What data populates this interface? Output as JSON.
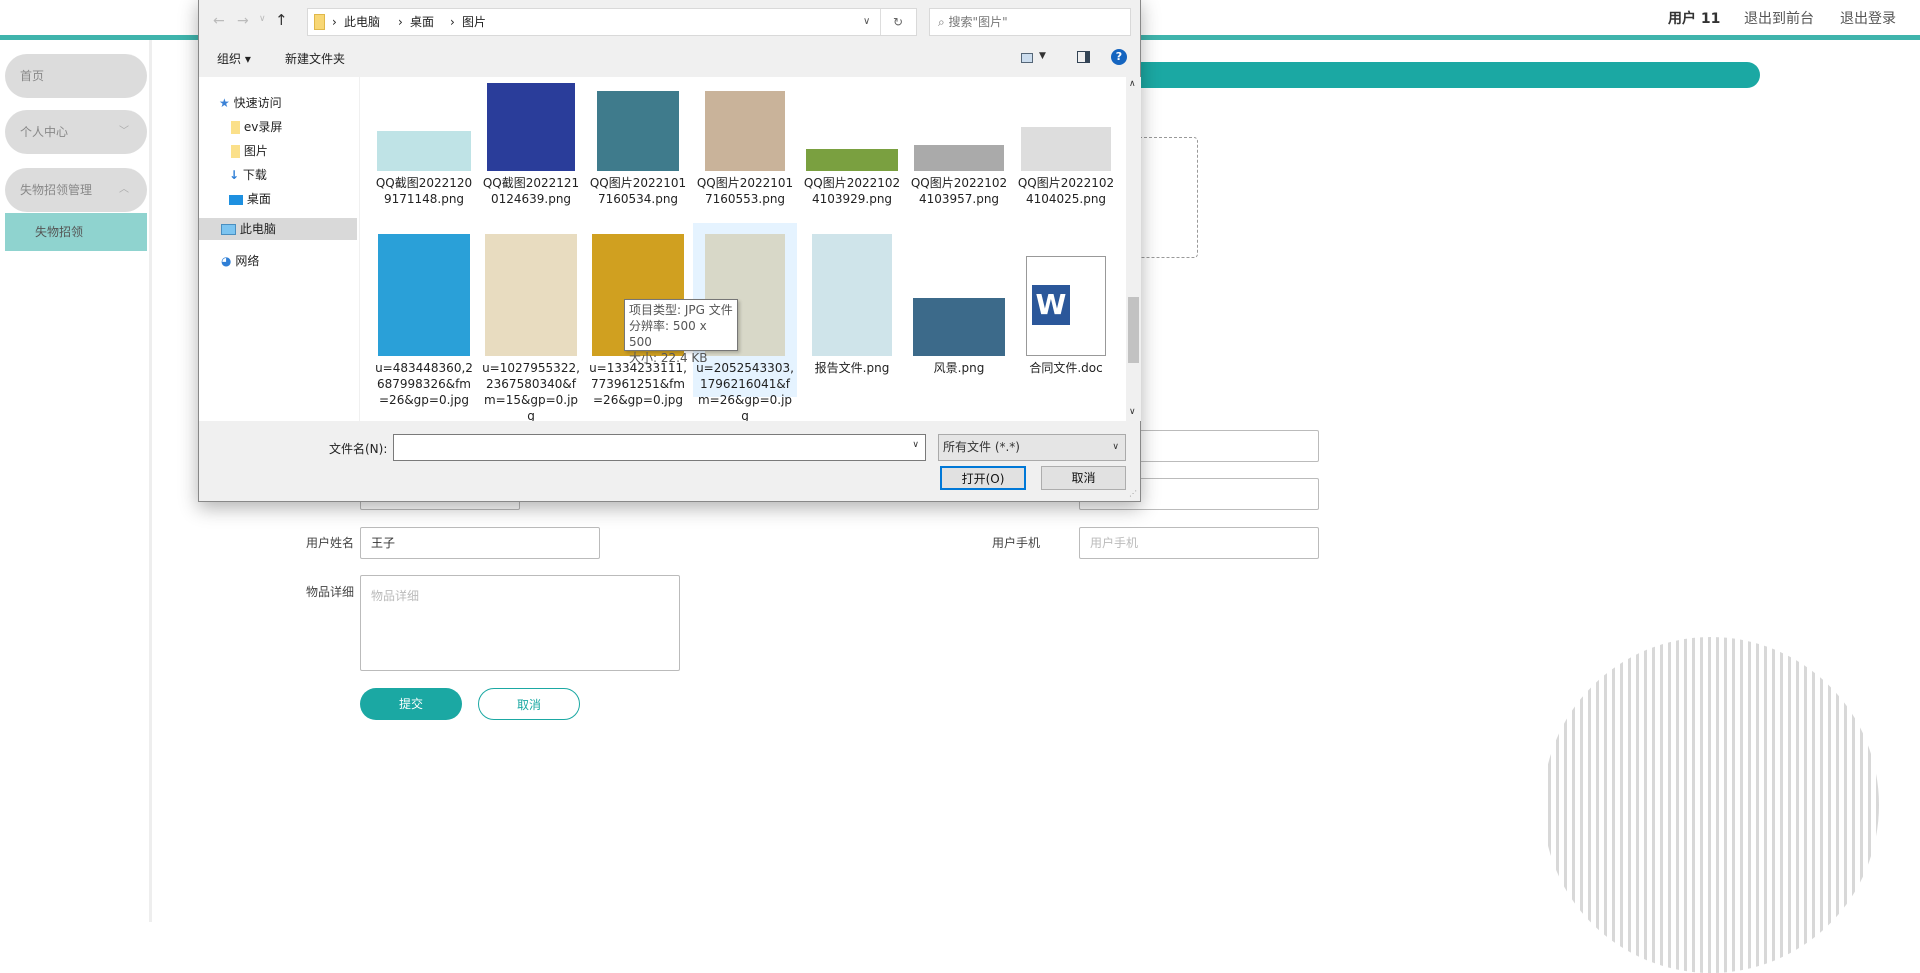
{
  "header": {
    "user": "用户 11",
    "back_front": "退出到前台",
    "logout": "退出登录"
  },
  "colors": {
    "accent": "#1ba8a3",
    "sidebar_active": "#8fd3cf"
  },
  "sidebar": {
    "items": [
      {
        "label": "首页"
      },
      {
        "label": "个人中心",
        "icon": "chevron-down-icon"
      },
      {
        "label": "失物招领管理",
        "icon": "chevron-up-icon"
      }
    ],
    "active_sub": "失物招领"
  },
  "form": {
    "name_label": "用户姓名",
    "name_value": "王子",
    "phone_label": "用户手机",
    "phone_placeholder": "用户手机",
    "detail_label": "物品详细",
    "detail_placeholder": "物品详细",
    "submit": "提交",
    "cancel": "取消"
  },
  "dialog": {
    "breadcrumb": [
      "此电脑",
      "桌面",
      "图片"
    ],
    "search_placeholder": "搜索\"图片\"",
    "toolbar": {
      "organize": "组织 ▾",
      "new_folder": "新建文件夹"
    },
    "nav": [
      {
        "label": "快速访问",
        "icon": "star-icon"
      },
      {
        "label": "ev录屏",
        "icon": "folder-icon"
      },
      {
        "label": "图片",
        "icon": "folder-icon"
      },
      {
        "label": "下载",
        "icon": "download-icon"
      },
      {
        "label": "桌面",
        "icon": "desktop-icon"
      },
      {
        "label": "此电脑",
        "icon": "computer-icon"
      },
      {
        "label": "网络",
        "icon": "network-icon"
      }
    ],
    "files_row1": [
      {
        "name": "QQ截图20221209171148.png"
      },
      {
        "name": "QQ截图20221210124639.png"
      },
      {
        "name": "QQ图片20221017160534.png"
      },
      {
        "name": "QQ图片20221017160553.png"
      },
      {
        "name": "QQ图片20221024103929.png"
      },
      {
        "name": "QQ图片20221024103957.png"
      },
      {
        "name": "QQ图片20221024104025.png"
      }
    ],
    "files_row2": [
      {
        "name": "u=483448360,2687998326&fm=26&gp=0.jpg"
      },
      {
        "name": "u=1027955322,2367580340&fm=15&gp=0.jpg"
      },
      {
        "name": "u=1334233111,773961251&fm=26&gp=0.jpg"
      },
      {
        "name": "u=2052543303,1796216041&fm=26&gp=0.jpg"
      },
      {
        "name": "报告文件.png"
      },
      {
        "name": "风景.png"
      },
      {
        "name": "合同文件.doc"
      }
    ],
    "tooltip": {
      "type": "项目类型: JPG 文件",
      "resolution": "分辨率: 500 x 500",
      "size": "大小: 22.4 KB"
    },
    "filename_label": "文件名(N):",
    "filename_value": "",
    "filetype": "所有文件 (*.*)",
    "open": "打开(O)",
    "cancel": "取消"
  }
}
